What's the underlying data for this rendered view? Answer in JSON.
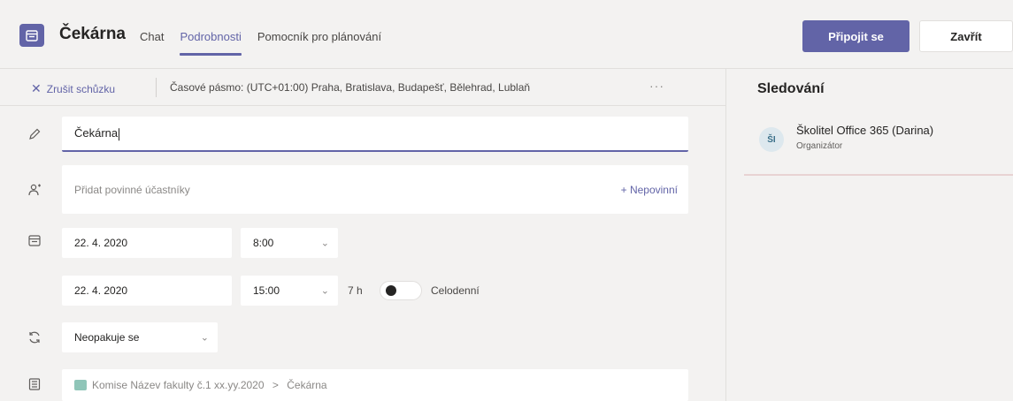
{
  "header": {
    "title": "Čekárna",
    "tabs": [
      {
        "label": "Chat",
        "active": false
      },
      {
        "label": "Podrobnosti",
        "active": true
      },
      {
        "label": "Pomocník pro plánování",
        "active": false
      }
    ],
    "join_label": "Připojit se",
    "close_label": "Zavřít",
    "accent": "#6264a7"
  },
  "subbar": {
    "cancel_label": "Zrušit schůzku",
    "timezone": "Časové pásmo: (UTC+01:00) Praha, Bratislava, Budapešť, Bělehrad, Lublaň",
    "more": "···"
  },
  "form": {
    "title_value": "Čekárna",
    "attendees_placeholder": "Přidat povinné účastníky",
    "optional_label": "+ Nepovinní",
    "start_date": "22. 4. 2020",
    "start_time": "8:00",
    "end_date": "22. 4. 2020",
    "end_time": "15:00",
    "duration": "7 h",
    "allday_label": "Celodenní",
    "repeat": "Neopakuje se",
    "channel": "Komise Název fakulty č.1 xx.yy.2020",
    "channel_sep": ">",
    "channel_target": "Čekárna"
  },
  "tracking": {
    "title": "Sledování",
    "attendee": {
      "initials": "ŠI",
      "name": "Školitel Office 365 (Darina)",
      "role": "Organizátor"
    }
  }
}
